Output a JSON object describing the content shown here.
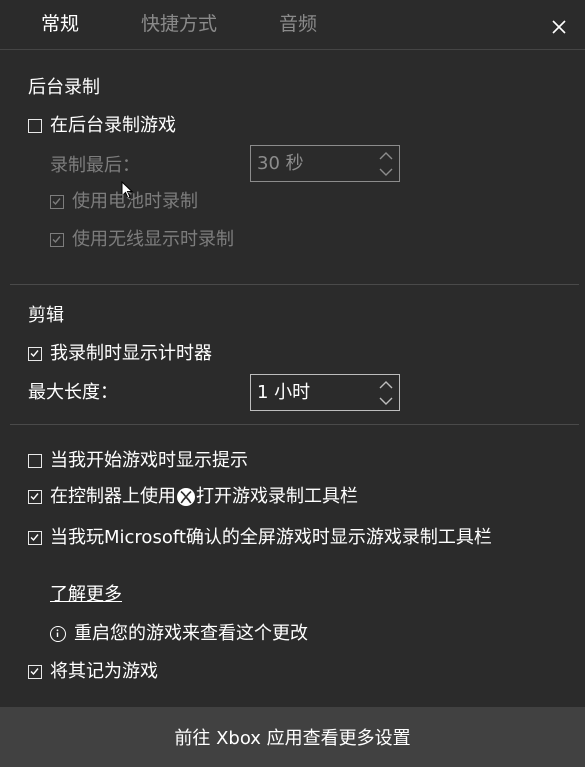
{
  "tabs": [
    {
      "label": "常规",
      "active": true
    },
    {
      "label": "快捷方式",
      "active": false
    },
    {
      "label": "音频",
      "active": false
    }
  ],
  "background_recording": {
    "heading": "后台录制",
    "record_in_background": {
      "label": "在后台录制游戏",
      "checked": false
    },
    "record_last_label": "录制最后：",
    "record_last_value": "30 秒",
    "battery_record": {
      "label": "使用电池时录制",
      "checked": true
    },
    "wireless_display_record": {
      "label": "使用无线显示时录制",
      "checked": true
    }
  },
  "clips": {
    "heading": "剪辑",
    "show_timer": {
      "label": "我录制时显示计时器",
      "checked": true
    },
    "max_length_label": "最大长度：",
    "max_length_value": "1 小时"
  },
  "misc": {
    "show_tips": {
      "label": "当我开始游戏时显示提示",
      "checked": false
    },
    "controller_open_pre": "在控制器上使用",
    "controller_open_post": "打开游戏录制工具栏",
    "controller_open_checked": true,
    "fullscreen_toolbar": {
      "label": "当我玩Microsoft确认的全屏游戏时显示游戏录制工具栏",
      "checked": true
    },
    "learn_more": "了解更多",
    "restart_info": "重启您的游戏来查看这个更改",
    "remember_as_game": {
      "label": "将其记为游戏",
      "checked": true
    }
  },
  "footer": {
    "label": "前往 Xbox 应用查看更多设置"
  },
  "colors": {
    "background": "#2b2b2b",
    "footer": "#414141",
    "disabled": "#7d7d7d"
  }
}
